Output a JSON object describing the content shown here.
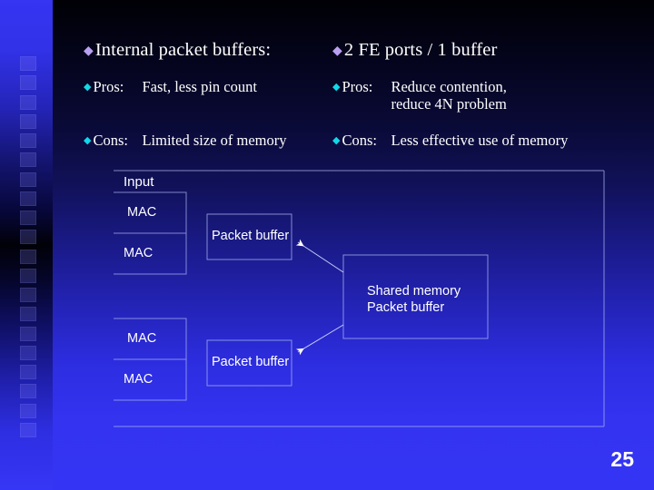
{
  "slide": {
    "page_number": "25",
    "colors": {
      "background_top": "#000005",
      "background_bottom": "#3434f5",
      "lead_bullet_marker": "#b9a0f0",
      "sub_bullet_marker": "#10d8e8",
      "text": "#ffffff",
      "diagram_line": "#aab4f0"
    }
  },
  "columns": {
    "left": {
      "heading": {
        "marker": "diamond-bullet-icon",
        "text": "Internal packet buffers:"
      },
      "rows": [
        {
          "marker": "diamond-sub-bullet-icon",
          "label": "Pros:",
          "lines": [
            "Fast, less pin count"
          ]
        },
        {
          "marker": "diamond-sub-bullet-icon",
          "label": "Cons:",
          "lines": [
            "Limited size of memory"
          ]
        }
      ]
    },
    "right": {
      "heading": {
        "marker": "diamond-bullet-icon",
        "text": "2 FE ports / 1 buffer"
      },
      "rows": [
        {
          "marker": "diamond-sub-bullet-icon",
          "label": "Pros:",
          "lines": [
            "Reduce contention,",
            "reduce 4N problem"
          ]
        },
        {
          "marker": "diamond-sub-bullet-icon",
          "label": "Cons:",
          "lines": [
            "Less effective use of memory"
          ]
        }
      ]
    }
  },
  "diagram": {
    "input_label": "Input",
    "mac_boxes": [
      {
        "label": "MAC"
      },
      {
        "label": "MAC"
      },
      {
        "label": "MAC"
      },
      {
        "label": "MAC"
      }
    ],
    "packet_buffers": [
      {
        "label": "Packet buffer"
      },
      {
        "label": "Packet buffer"
      }
    ],
    "shared_memory": {
      "line1": "Shared memory",
      "line2": "Packet buffer"
    },
    "arrows": [
      {
        "from": "shared-memory",
        "to": "packet-buffer-top"
      },
      {
        "from": "shared-memory",
        "to": "packet-buffer-bottom"
      }
    ]
  }
}
